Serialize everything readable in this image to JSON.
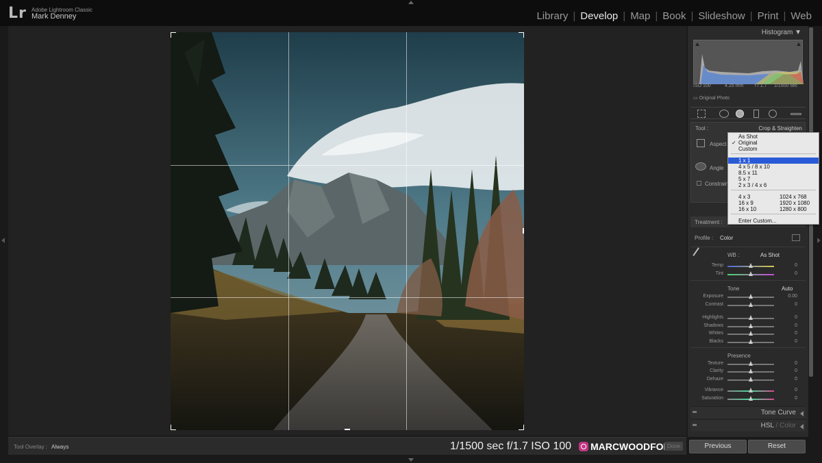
{
  "app": {
    "logo": "Lr",
    "name": "Adobe Lightroom Classic",
    "user": "Mark Denney"
  },
  "modules": [
    "Library",
    "Develop",
    "Map",
    "Book",
    "Slideshow",
    "Print",
    "Web"
  ],
  "active_module": "Develop",
  "toolbar": {
    "tool_overlay_label": "Tool Overlay :",
    "tool_overlay_value": "Always",
    "exif": "1/1500 sec f/1.7 ISO 100",
    "instagram_handle": "MARCWOODFORD",
    "done_label": "Done"
  },
  "histogram": {
    "title": "Histogram",
    "iso": "ISO 100",
    "focal": "4.25 mm",
    "aperture": "f / 1.7",
    "shutter": "1/1500 sec",
    "original_photo": "Original Photo"
  },
  "crop": {
    "tool_label": "Tool :",
    "tool_value": "Crop & Straighten",
    "aspect_label": "Aspect",
    "angle_label": "Angle",
    "constrain_label": "Constrain"
  },
  "aspect_menu": {
    "items": [
      {
        "label": "As Shot",
        "checked": false,
        "selected": false,
        "value": ""
      },
      {
        "label": "Original",
        "checked": true,
        "selected": false,
        "value": ""
      },
      {
        "label": "Custom",
        "checked": false,
        "selected": false,
        "value": ""
      },
      {
        "label": "1 x 1",
        "checked": false,
        "selected": true,
        "value": ""
      },
      {
        "label": "4 x 5 / 8 x 10",
        "checked": false,
        "selected": false,
        "value": ""
      },
      {
        "label": "8.5 x 11",
        "checked": false,
        "selected": false,
        "value": ""
      },
      {
        "label": "5 x 7",
        "checked": false,
        "selected": false,
        "value": ""
      },
      {
        "label": "2 x 3 / 4 x 6",
        "checked": false,
        "selected": false,
        "value": ""
      },
      {
        "label": "4 x 3",
        "checked": false,
        "selected": false,
        "value": "1024 x 768"
      },
      {
        "label": "16 x 9",
        "checked": false,
        "selected": false,
        "value": "1920 x 1080"
      },
      {
        "label": "16 x 10",
        "checked": false,
        "selected": false,
        "value": "1280 x 800"
      },
      {
        "label": "Enter Custom...",
        "checked": false,
        "selected": false,
        "value": ""
      }
    ]
  },
  "basic": {
    "treatment_label": "Treatment :",
    "profile_label": "Profile :",
    "profile_value": "Color",
    "wb_label": "WB :",
    "wb_value": "As Shot",
    "tone_label": "Tone",
    "auto_label": "Auto",
    "presence_label": "Presence",
    "sliders": [
      {
        "name": "Temp",
        "value": "0",
        "level": 0.5
      },
      {
        "name": "Tint",
        "value": "0",
        "level": 0.5
      },
      {
        "name": "Exposure",
        "value": "0.00",
        "level": 0.5
      },
      {
        "name": "Contrast",
        "value": "0",
        "level": 0.5
      },
      {
        "name": "Highlights",
        "value": "0",
        "level": 0.5
      },
      {
        "name": "Shadows",
        "value": "0",
        "level": 0.5
      },
      {
        "name": "Whites",
        "value": "0",
        "level": 0.5
      },
      {
        "name": "Blacks",
        "value": "0",
        "level": 0.5
      },
      {
        "name": "Texture",
        "value": "0",
        "level": 0.5
      },
      {
        "name": "Clarity",
        "value": "0",
        "level": 0.5
      },
      {
        "name": "Dehaze",
        "value": "0",
        "level": 0.5
      },
      {
        "name": "Vibrance",
        "value": "0",
        "level": 0.5
      },
      {
        "name": "Saturation",
        "value": "0",
        "level": 0.5
      }
    ]
  },
  "panels": {
    "tone_curve": "Tone Curve",
    "hsl_a": "HSL",
    "hsl_sep": " / ",
    "hsl_b": "Color"
  },
  "buttons": {
    "previous": "Previous",
    "reset": "Reset"
  },
  "colors": {
    "accent_select": "#2a5bd7",
    "panel_bg": "#2a2a2a"
  }
}
